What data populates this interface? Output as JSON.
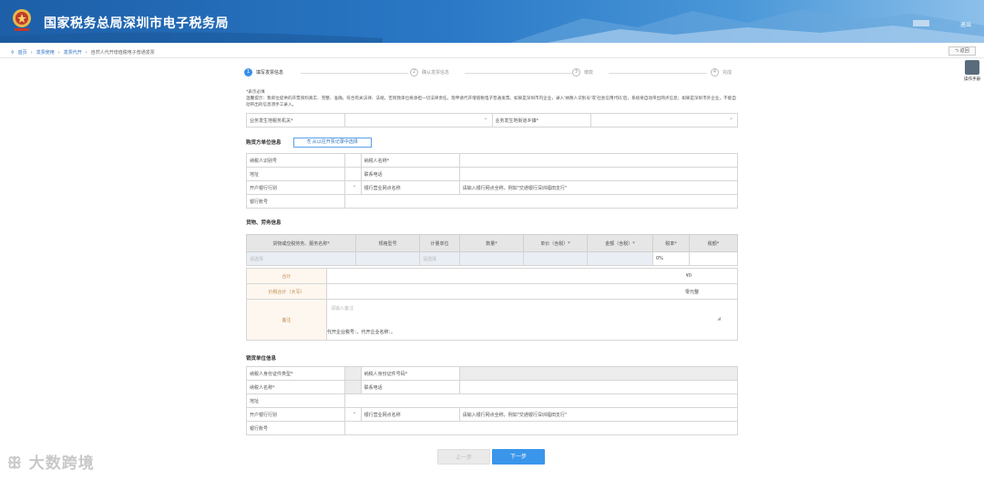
{
  "header": {
    "title": "国家税务总局深圳市电子税务局",
    "logout": "退出",
    "brand_color": "#2a78c6"
  },
  "breadcrumb": [
    "首页",
    "发票使用",
    "发票代开",
    "自然人代开增值税电子普通发票"
  ],
  "back_button": "返回",
  "guide_label": "操作手册",
  "steps": [
    {
      "num": "1",
      "label": "填写发票信息"
    },
    {
      "num": "2",
      "label": "确认发票信息"
    },
    {
      "num": "3",
      "label": "缴款"
    },
    {
      "num": "4",
      "label": "完成"
    }
  ],
  "notice": {
    "title": "*表示必填",
    "text": "温馨提示：我单位提供的开票资料真实、完整、准确，符合有关法律、法规，否则我单位将承担一切法律责任。现申请代开增值税电子普通发票。如果是深圳市内企业，录入'纳税人识别号'或'社会信用代码'后，系统将自动带出网点信息；如果是深圳市外企业，不能自动带出的信息须手工录入。"
  },
  "office_row": {
    "label1": "业务发生地税务机关*",
    "label2": "业务发生地街道乡镇*"
  },
  "buyer": {
    "section": "购货方单位信息",
    "import_button": "从以往开票记录中选择",
    "taxid": "纳税人识别号",
    "name": "纳税人名称*",
    "address": "地址",
    "phone": "联系电话",
    "bank": "开户银行行别",
    "branch": "银行营业网点名称",
    "branch_placeholder": "请输入银行网点全称，例如\"交通银行深圳福田支行\"",
    "account": "银行账号"
  },
  "goods": {
    "section": "货物、劳务信息",
    "headers": [
      "货物或应税劳务、服务名称*",
      "规格型号",
      "计量单位",
      "数量*",
      "单价（含税）*",
      "金额（含税）*",
      "税率*",
      "税额*"
    ],
    "row_placeholder": "请选择",
    "unit_placeholder": "请选择",
    "rate": "0%"
  },
  "summary": {
    "total_label": "合计",
    "total_value": "¥0",
    "total_tax_label": "价税合计（大写）",
    "total_tax_value": "零元整",
    "remark_label": "备注",
    "remark_placeholder": "请输入备注",
    "remark_text": "代开企业税号：，代开企业名称：。"
  },
  "seller": {
    "section": "销货单位信息",
    "id_type": "纳税人身份证件类型*",
    "id_no": "纳税人身份证件号码*",
    "name": "纳税人名称*",
    "phone": "联系电话",
    "address": "地址",
    "bank": "开户银行行别",
    "branch": "银行营业网点名称",
    "branch_placeholder": "请输入银行网点全称，例如\"交通银行深圳福田支行\"",
    "account": "银行账号"
  },
  "buttons": {
    "prev": "上一步",
    "next": "下一步"
  },
  "watermark": "大数跨境"
}
